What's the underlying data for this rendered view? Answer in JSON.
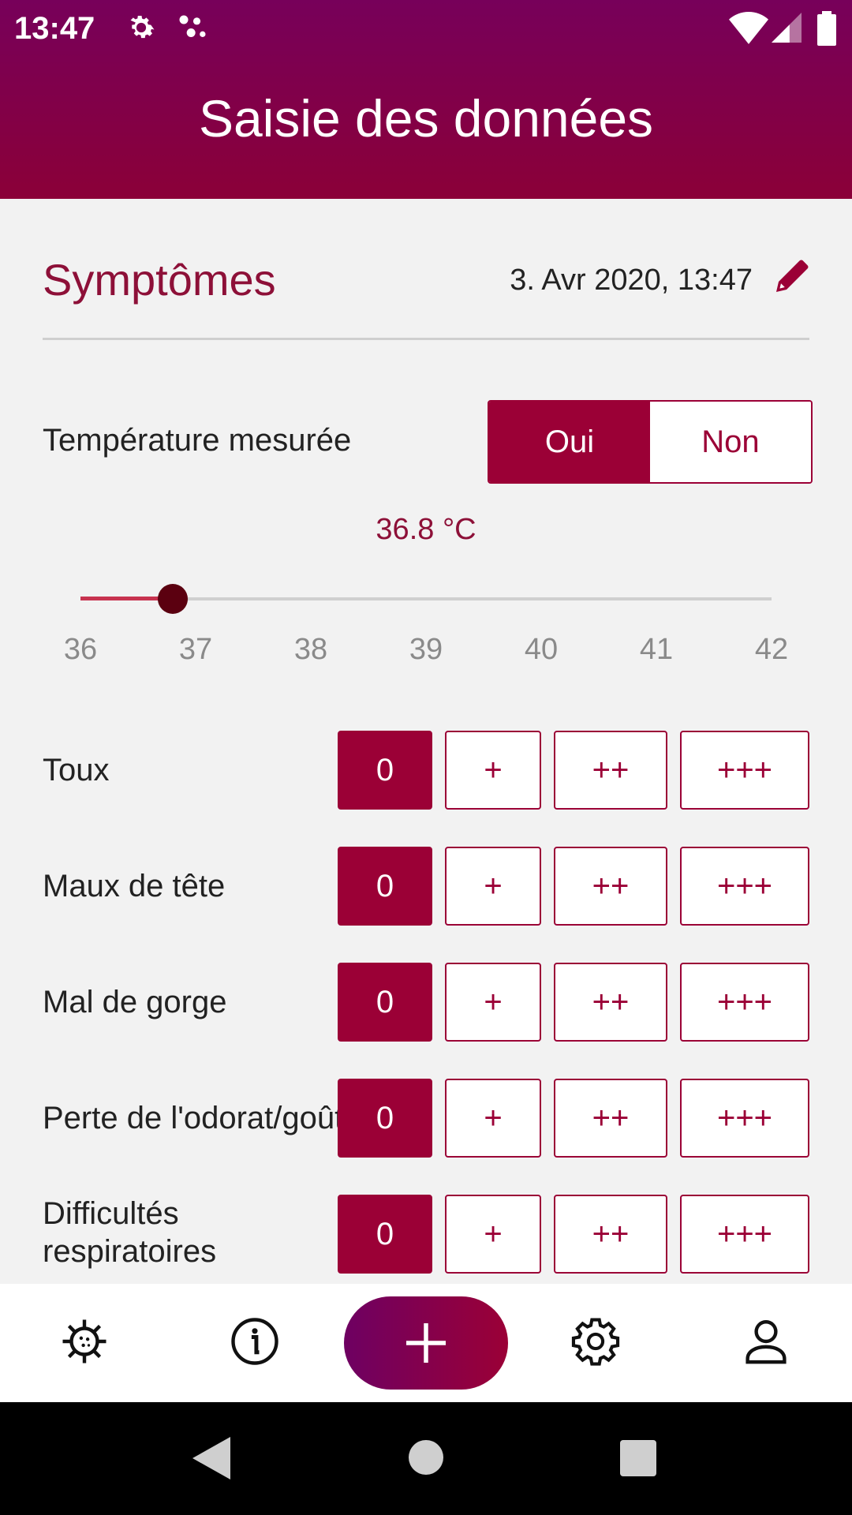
{
  "statusbar": {
    "time": "13:47"
  },
  "header": {
    "title": "Saisie des données"
  },
  "section": {
    "title": "Symptômes",
    "datetime": "3. Avr 2020, 13:47"
  },
  "temperature": {
    "label": "Température mesurée",
    "yes_label": "Oui",
    "no_label": "Non",
    "selected": "Oui",
    "value_text": "36.8 °C",
    "value": 36.8,
    "min": 36,
    "max": 42,
    "ticks": [
      "36",
      "37",
      "38",
      "39",
      "40",
      "41",
      "42"
    ]
  },
  "severity_options": [
    "0",
    "+",
    "++",
    "+++"
  ],
  "symptoms": [
    {
      "label": "Toux",
      "selected": "0"
    },
    {
      "label": "Maux de tête",
      "selected": "0"
    },
    {
      "label": "Mal de gorge",
      "selected": "0"
    },
    {
      "label": "Perte de l'odorat/goût",
      "selected": "0"
    },
    {
      "label": "Difficultés respiratoires",
      "selected": "0"
    }
  ],
  "colors": {
    "primary": "#9b0036",
    "header_top": "#77005a",
    "header_bottom": "#8b0038"
  },
  "bottom_nav": {
    "items": [
      {
        "icon": "virus-icon"
      },
      {
        "icon": "info-icon"
      },
      {
        "icon": "plus-icon"
      },
      {
        "icon": "gear-icon"
      },
      {
        "icon": "user-icon"
      }
    ]
  }
}
